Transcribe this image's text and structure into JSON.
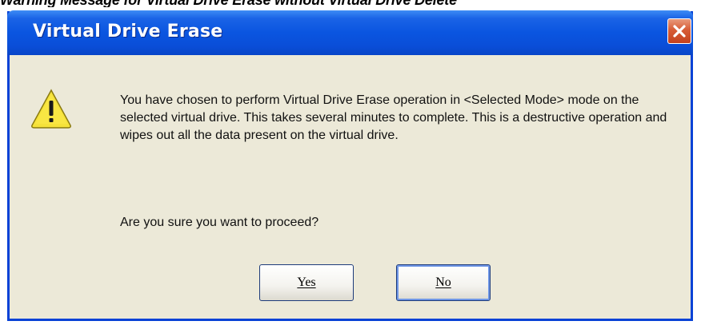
{
  "caption": "Warning Message for Virtual Drive Erase without Virtual Drive Delete",
  "dialog": {
    "title": "Virtual Drive Erase",
    "message": "You have chosen to perform Virtual Drive Erase operation in <Selected Mode> mode on the selected virtual drive. This takes several minutes to complete. This is a destructive operation and wipes out all the data present on the virtual drive.",
    "question": "Are you sure you want to proceed?",
    "yes_label": "Yes",
    "no_label": "No",
    "icons": {
      "close": "close-icon",
      "warning": "warning-icon"
    },
    "colors": {
      "titlebar": "#0a55e0",
      "close_button": "#d75c36",
      "body": "#ece9d8",
      "warning": "#f5e23a"
    }
  }
}
